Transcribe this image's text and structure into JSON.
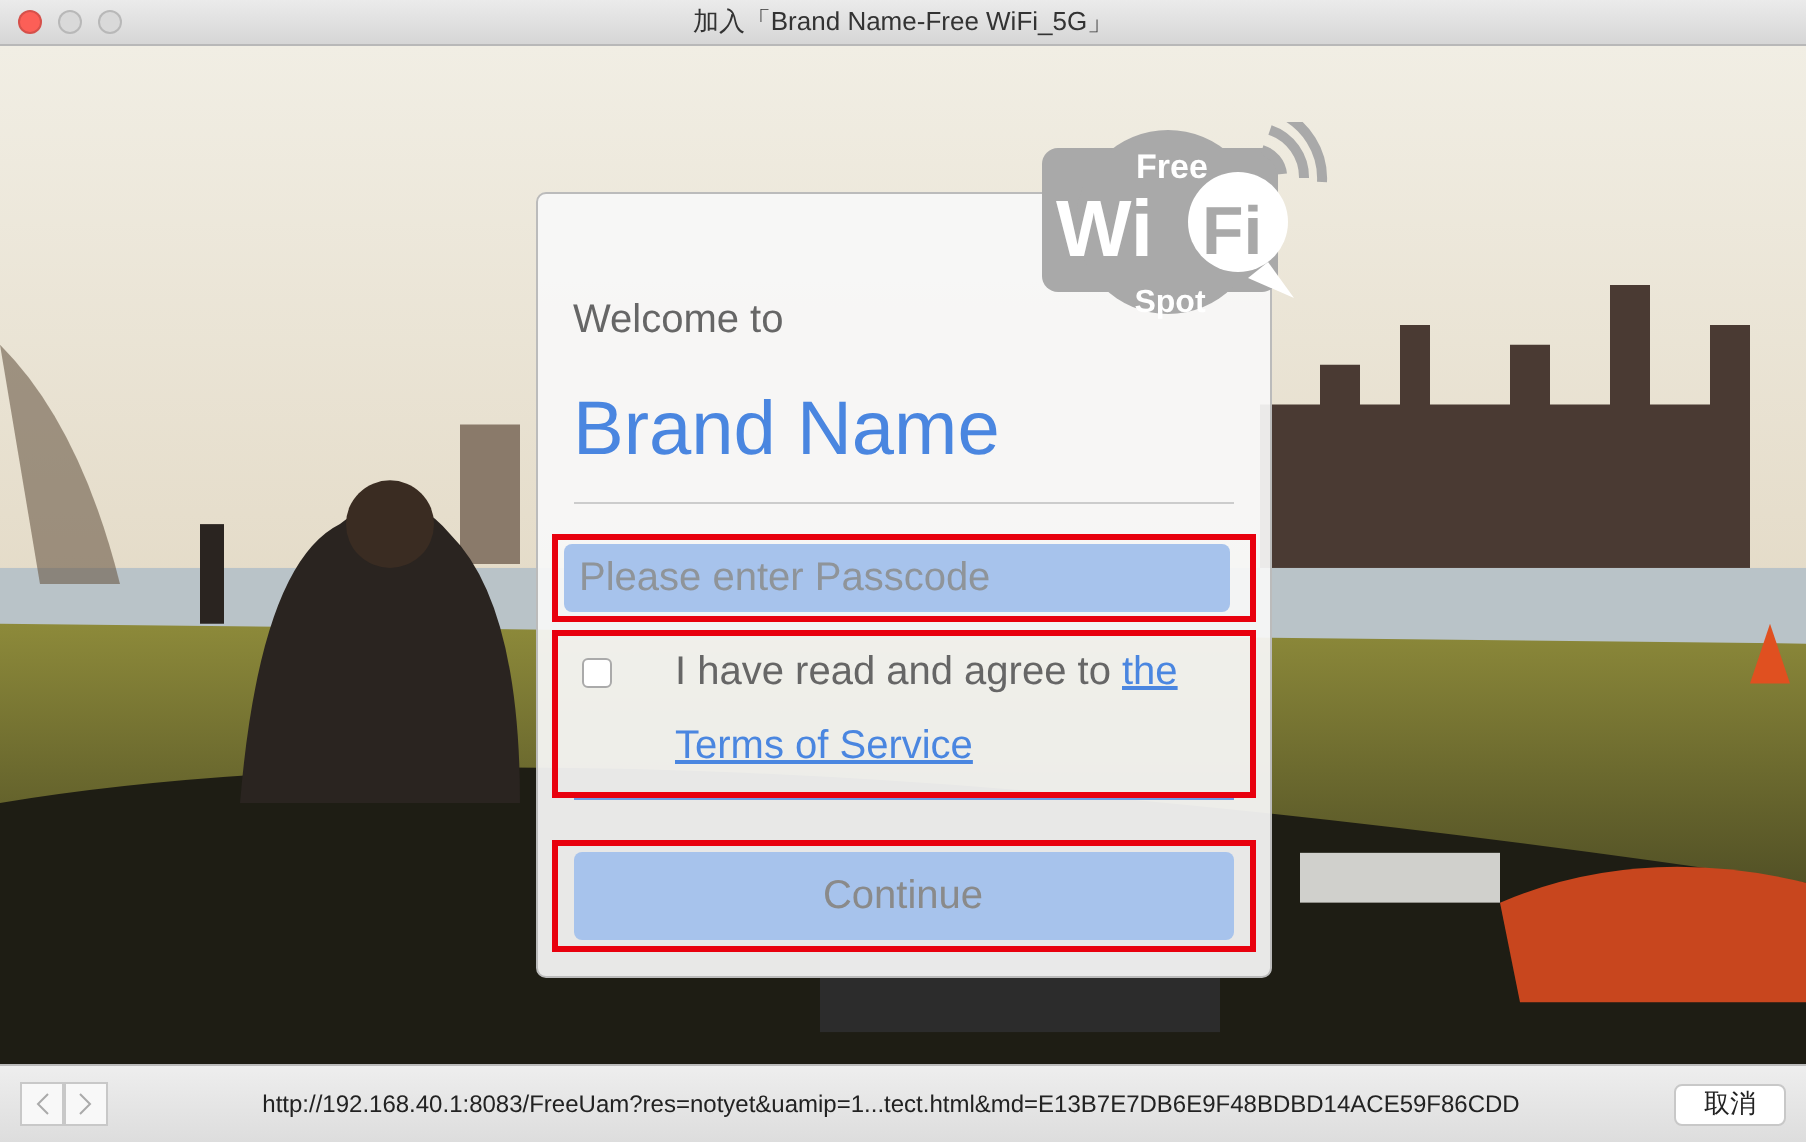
{
  "window": {
    "title": "加入「Brand Name-Free WiFi_5G」"
  },
  "logo": {
    "top": "Free",
    "left": "Wi",
    "right": "Fi",
    "bottom": "Spot"
  },
  "card": {
    "welcome": "Welcome to",
    "brand": "Brand Name",
    "passcode": {
      "placeholder": "Please enter Passcode",
      "highlighted": true
    },
    "agreement": {
      "text": "I have read and agree to ",
      "link_parts": [
        "the",
        "Terms of Service"
      ],
      "checked": false,
      "highlighted": true
    },
    "continue_button": {
      "label": "Continue",
      "disabled": true,
      "highlighted": true
    }
  },
  "bottom_bar": {
    "url": "http://192.168.40.1:8083/FreeUam?res=notyet&uamip=1...tect.html&md=E13B7E7DB6E9F48BDBD14ACE59F86CDD",
    "cancel": "取消"
  }
}
